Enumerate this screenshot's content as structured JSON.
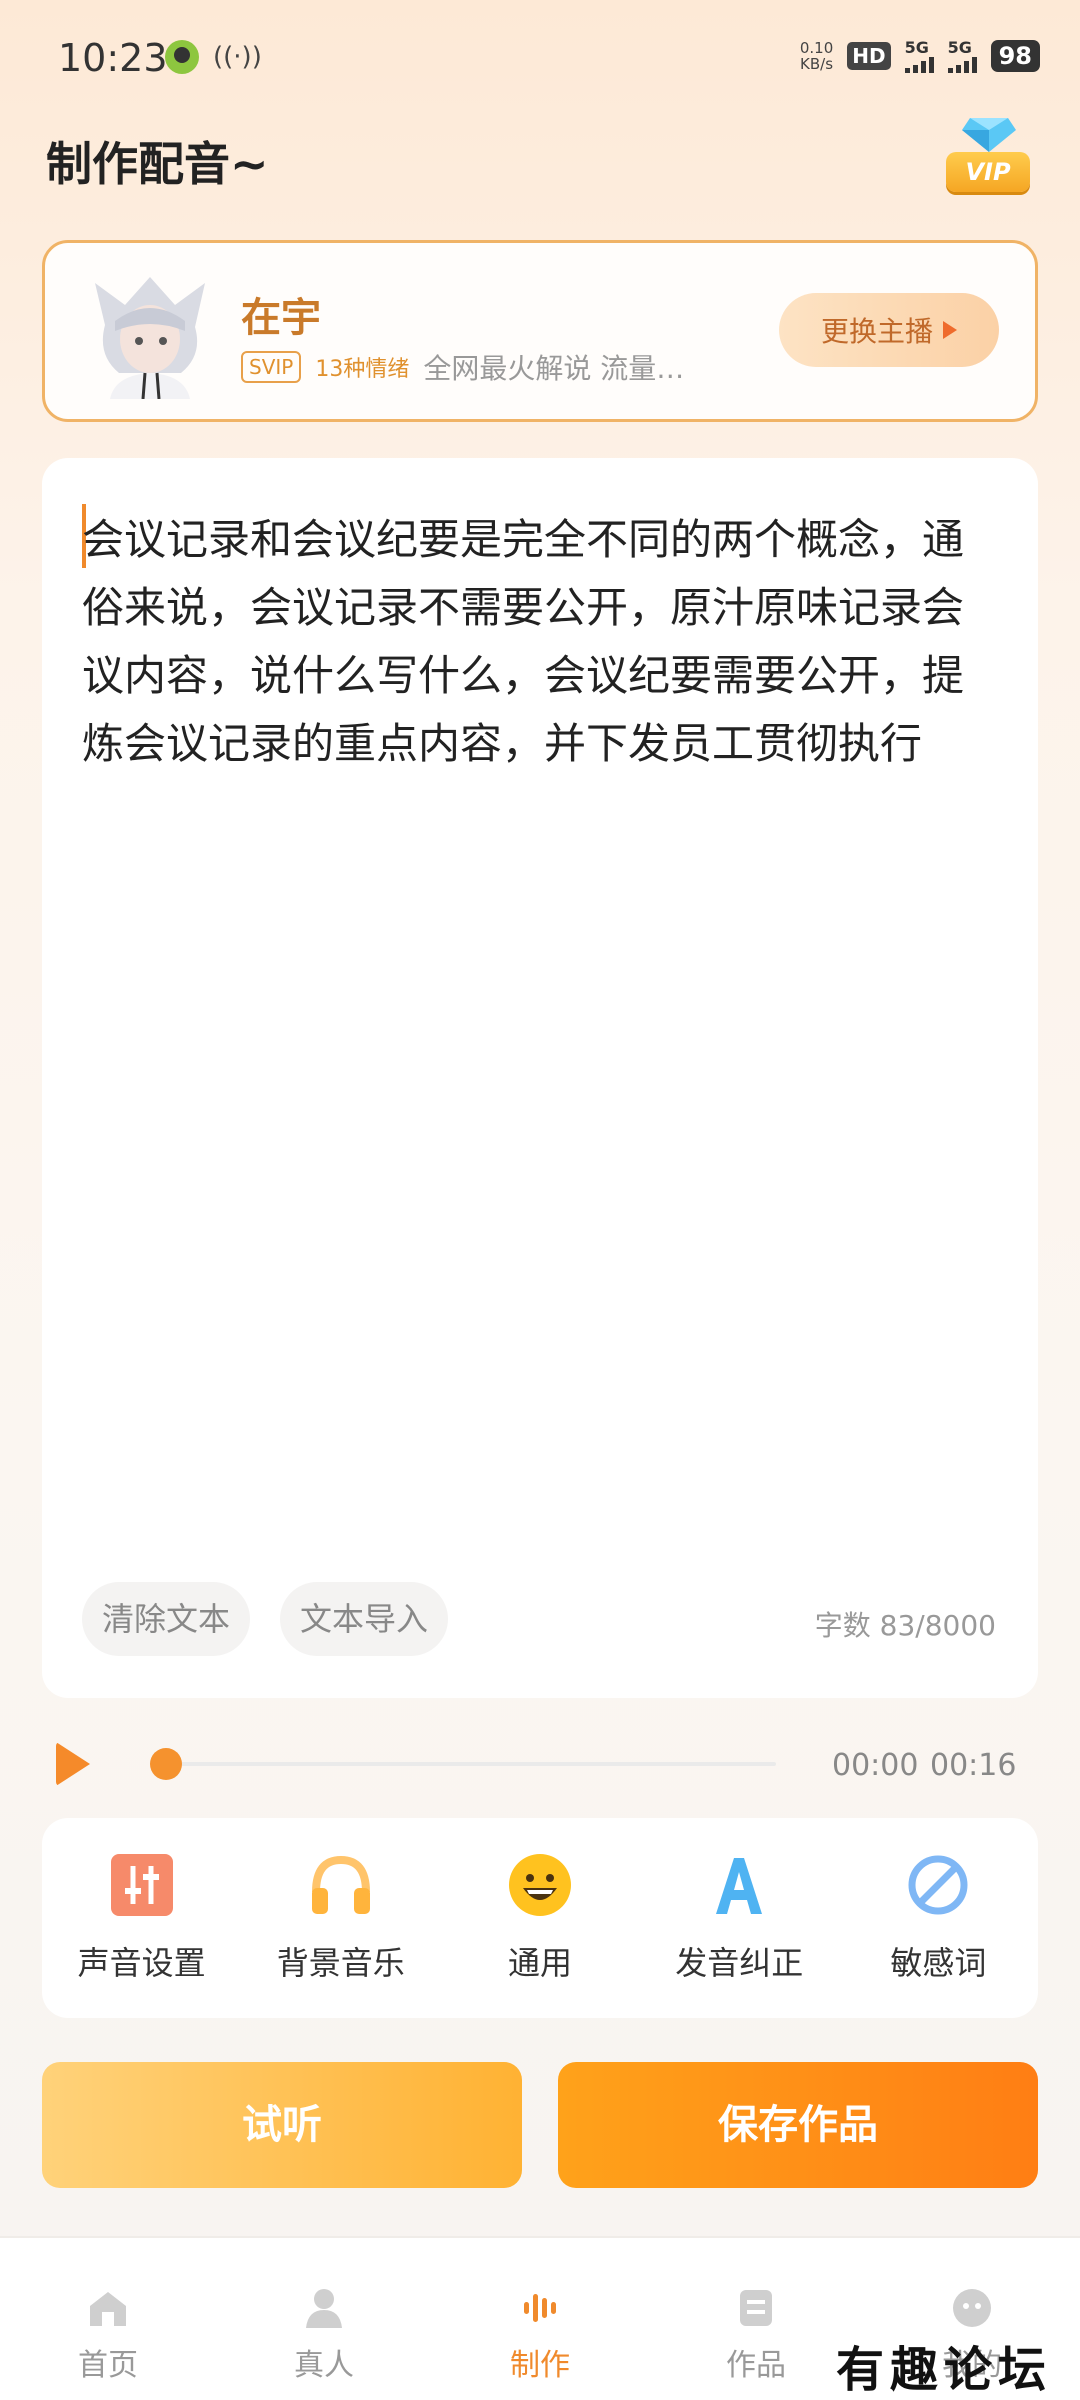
{
  "status": {
    "time": "10:23",
    "net_speed_value": "0.10",
    "net_speed_unit": "KB/s",
    "hd": "HD",
    "hd_sub": "1 2",
    "sig1": "5G",
    "sig2": "5G",
    "battery": "98"
  },
  "header": {
    "title": "制作配音~",
    "vip_label": "VIP"
  },
  "anchor": {
    "name": "在宇",
    "svip": "SVIP",
    "emotions": "13种情绪",
    "desc": "全网最火解说 流量…",
    "change_label": "更换主播"
  },
  "editor": {
    "text": "会议记录和会议纪要是完全不同的两个概念，通俗来说，会议记录不需要公开，原汁原味记录会议内容，说什么写什么，会议纪要需要公开，提炼会议记录的重点内容，并下发员工贯彻执行",
    "clear_label": "清除文本",
    "import_label": "文本导入",
    "word_count": "字数 83/8000"
  },
  "player": {
    "current": "00:00",
    "total": "00:16",
    "progress": 0
  },
  "tools": [
    {
      "label": "声音设置",
      "icon": "sliders-icon"
    },
    {
      "label": "背景音乐",
      "icon": "headphones-icon"
    },
    {
      "label": "通用",
      "icon": "smile-icon"
    },
    {
      "label": "发音纠正",
      "icon": "letter-a-icon"
    },
    {
      "label": "敏感词",
      "icon": "ban-icon"
    }
  ],
  "actions": {
    "audition": "试听",
    "save": "保存作品"
  },
  "nav": [
    {
      "label": "首页",
      "icon": "home-icon"
    },
    {
      "label": "真人",
      "icon": "person-icon"
    },
    {
      "label": "制作",
      "icon": "waveform-icon",
      "active": true
    },
    {
      "label": "作品",
      "icon": "works-icon"
    },
    {
      "label": "我的",
      "icon": "face-icon"
    }
  ],
  "watermark": "有趣论坛",
  "colors": {
    "accent": "#f08a2c",
    "anchor_name": "#c97a2a",
    "save_btn": "#ff8a14"
  }
}
